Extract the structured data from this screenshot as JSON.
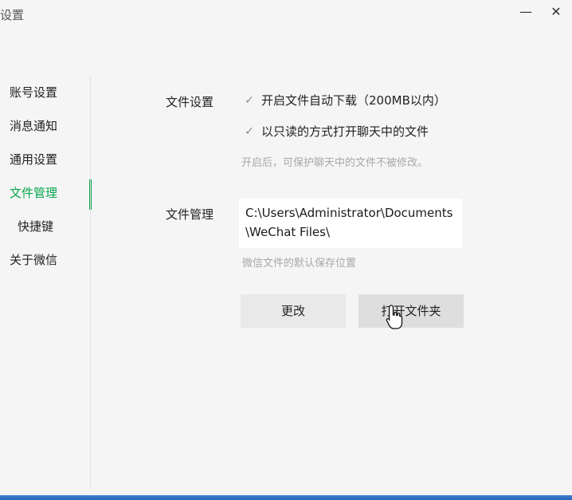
{
  "window": {
    "title": "设置",
    "minimize_label": "—",
    "close_label": "✕"
  },
  "sidebar": {
    "items": [
      {
        "label": "账号设置"
      },
      {
        "label": "消息通知"
      },
      {
        "label": "通用设置"
      },
      {
        "label": "文件管理",
        "active": true
      },
      {
        "label": "快捷键"
      },
      {
        "label": "关于微信"
      }
    ]
  },
  "file_settings": {
    "label": "文件设置",
    "auto_download": {
      "checked": true,
      "text": "开启文件自动下载（200MB以内）"
    },
    "readonly_open": {
      "checked": true,
      "text": "以只读的方式打开聊天中的文件"
    },
    "hint": "开启后，可保护聊天中的文件不被修改。"
  },
  "file_management": {
    "label": "文件管理",
    "path": "C:\\Users\\Administrator\\Documents\\WeChat Files\\",
    "hint": "微信文件的默认保存位置",
    "change_button": "更改",
    "open_folder_button": "打开文件夹"
  },
  "icons": {
    "check": "checkmark-icon",
    "cursor": "hand-pointer-icon"
  },
  "colors": {
    "accent": "#07a64c",
    "background": "#f5f5f5"
  }
}
